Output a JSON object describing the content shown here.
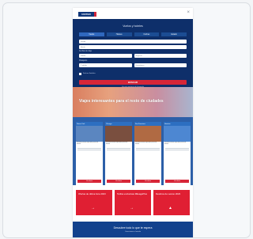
{
  "header": {
    "logo": "UNITED",
    "close": "×"
  },
  "booking": {
    "title": "Vuelos y hoteles",
    "tabs": [
      "Vuelos",
      "Hoteles",
      "Coches",
      "Estado"
    ],
    "from_placeholder": "Desde",
    "to_placeholder": "Hasta",
    "dates_label": "Fechas de viaje",
    "depart_placeholder": "Salida",
    "return_placeholder": "Regreso",
    "travelers_label": "Pasajeros",
    "travelers_value": "1 adulto",
    "class_value": "Económica",
    "flexible_label": "Fechas flexibles",
    "search_button": "BUSCAR",
    "sub_link": "Ver más opciones de búsqueda"
  },
  "banner": {
    "headline": "Viajes interesantes para el resto de ciudades"
  },
  "cards": [
    {
      "title": "Nueva York",
      "text": "Descubre ofertas especiales para este destino",
      "button": "Ver oferta",
      "img_color": "#5b86c0"
    },
    {
      "title": "Chicago",
      "text": "Descubre ofertas especiales para este destino",
      "button": "Ver oferta",
      "img_color": "#7a4f3f"
    },
    {
      "title": "San Francisco",
      "text": "Descubre ofertas especiales para este destino",
      "button": "Ver oferta",
      "img_color": "#b06a43"
    },
    {
      "title": "Houston",
      "text": "Descubre ofertas especiales para este destino",
      "button": "Ver oferta",
      "img_color": "#4d87d2"
    }
  ],
  "promos": [
    {
      "title": "Ofertas de última hora 2023",
      "icon": "→"
    },
    {
      "title": "Tarifas exclusivas MileagePlus",
      "icon": "→"
    },
    {
      "title": "Destinos de verano 2023",
      "icon": "▲"
    }
  ],
  "footer": {
    "title": "Descubre todo lo que te espera",
    "subtitle": "Conectamos el mundo"
  },
  "colors": {
    "navy": "#0e2f6a",
    "red": "#d72638",
    "blue": "#2c5fa8"
  }
}
